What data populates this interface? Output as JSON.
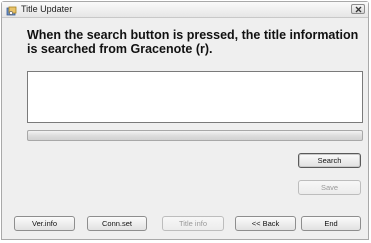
{
  "window": {
    "title": "Title Updater"
  },
  "main": {
    "message_line1": "When the search button is pressed, the title information",
    "message_line2": "is searched from Gracenote (r).",
    "result_text": "",
    "progress_fraction": 0
  },
  "buttons": {
    "search": "Search",
    "save": "Save",
    "ver_info": "Ver.info",
    "conn_set": "Conn.set",
    "title_info": "Title info",
    "back": "<< Back",
    "end": "End"
  },
  "icons": {
    "app": "app-icon",
    "close": "close-icon"
  }
}
